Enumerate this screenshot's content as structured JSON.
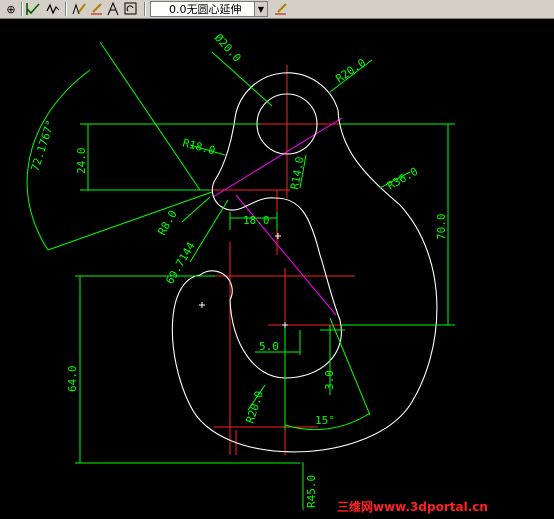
{
  "toolbar": {
    "style_selector_value": "0.0无圆心延伸",
    "buttons": [
      "target-icon",
      "check-icon",
      "wave-icon",
      "edit-text-icon",
      "edit-pen-icon",
      "text-a-icon",
      "update-icon",
      "edit-dim-icon"
    ]
  },
  "drawing": {
    "dimensions": {
      "d_top": "Ø20.0",
      "r_top_right": "R20.0",
      "angle_left": "72.1767°",
      "v_24": "24.0",
      "r18": "R18.0",
      "r14": "R14.0",
      "r36": "R36.0",
      "v_70": "70.0",
      "h_18": "18.0",
      "r8": "R8.0",
      "v_7144": "69.7144",
      "v_64": "64.0",
      "h_5": "5.0",
      "v_3": "3.0",
      "r20_bottom": "R20.0",
      "angle_15": "15°",
      "r45": "R45.0"
    }
  },
  "watermark": "三维网www.3dportal.cn"
}
